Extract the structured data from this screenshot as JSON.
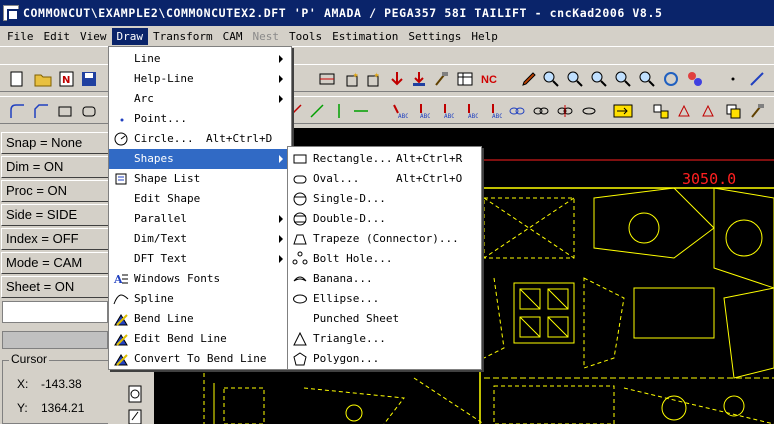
{
  "titlebar": {
    "text": "COMMONCUT\\EXAMPLE2\\COMMONCUTEX2.DFT  'P'  AMADA / PEGA357   58I      TAILIFT  - cncKad2006 V8.5"
  },
  "menubar": {
    "items": [
      "File",
      "Edit",
      "View",
      "Draw",
      "Transform",
      "CAM",
      "Nest",
      "Tools",
      "Estimation",
      "Settings",
      "Help"
    ]
  },
  "left_panel": {
    "status": [
      "Snap = None",
      "Dim  = ON",
      "Proc = ON",
      "Side  = SIDE",
      "Index = OFF",
      "Mode = CAM",
      "Sheet = ON"
    ],
    "cursor": {
      "legend": "Cursor",
      "x_label": "X:",
      "x_value": "-143.38",
      "y_label": "Y:",
      "y_value": "1364.21"
    }
  },
  "canvas": {
    "dimension_text": "3050.0",
    "colors": {
      "background": "#000000",
      "geometry": "#ffff00",
      "dimension": "#ff2020"
    }
  },
  "draw_menu": {
    "items": [
      {
        "label": "Line",
        "submenu": true
      },
      {
        "label": "Help-Line",
        "submenu": true
      },
      {
        "label": "Arc",
        "submenu": true
      },
      {
        "label": "Point...",
        "icon": "point-icon"
      },
      {
        "label": "Circle...",
        "shortcut": "Alt+Ctrl+D",
        "icon": "circle-icon"
      },
      {
        "label": "Shapes",
        "submenu": true,
        "highlighted": true
      },
      {
        "label": "Shape List",
        "icon": "shape-list-icon"
      },
      {
        "label": "Edit Shape"
      },
      {
        "label": "Parallel",
        "submenu": true
      },
      {
        "label": "Dim/Text",
        "submenu": true
      },
      {
        "label": "DFT Text",
        "submenu": true
      },
      {
        "label": "Windows Fonts",
        "icon": "windows-fonts-icon"
      },
      {
        "label": "Spline",
        "icon": "spline-icon"
      },
      {
        "label": "Bend Line",
        "icon": "bend-line-icon"
      },
      {
        "label": "Edit Bend Line",
        "icon": "edit-bend-line-icon"
      },
      {
        "label": "Convert To Bend Line",
        "icon": "convert-bend-line-icon"
      }
    ]
  },
  "shapes_menu": {
    "items": [
      {
        "label": "Rectangle...",
        "shortcut": "Alt+Ctrl+R",
        "icon": "rectangle-icon"
      },
      {
        "label": "Oval...",
        "shortcut": "Alt+Ctrl+O",
        "icon": "oval-icon"
      },
      {
        "label": "Single-D...",
        "icon": "single-d-icon"
      },
      {
        "label": "Double-D...",
        "icon": "double-d-icon"
      },
      {
        "label": "Trapeze (Connector)...",
        "icon": "trapeze-icon"
      },
      {
        "label": "Bolt Hole...",
        "icon": "bolt-hole-icon"
      },
      {
        "label": "Banana...",
        "icon": "banana-icon"
      },
      {
        "label": "Ellipse...",
        "icon": "ellipse-icon"
      },
      {
        "label": "Punched Sheet"
      },
      {
        "label": "Triangle...",
        "icon": "triangle-icon"
      },
      {
        "label": "Polygon...",
        "icon": "polygon-icon"
      }
    ]
  }
}
